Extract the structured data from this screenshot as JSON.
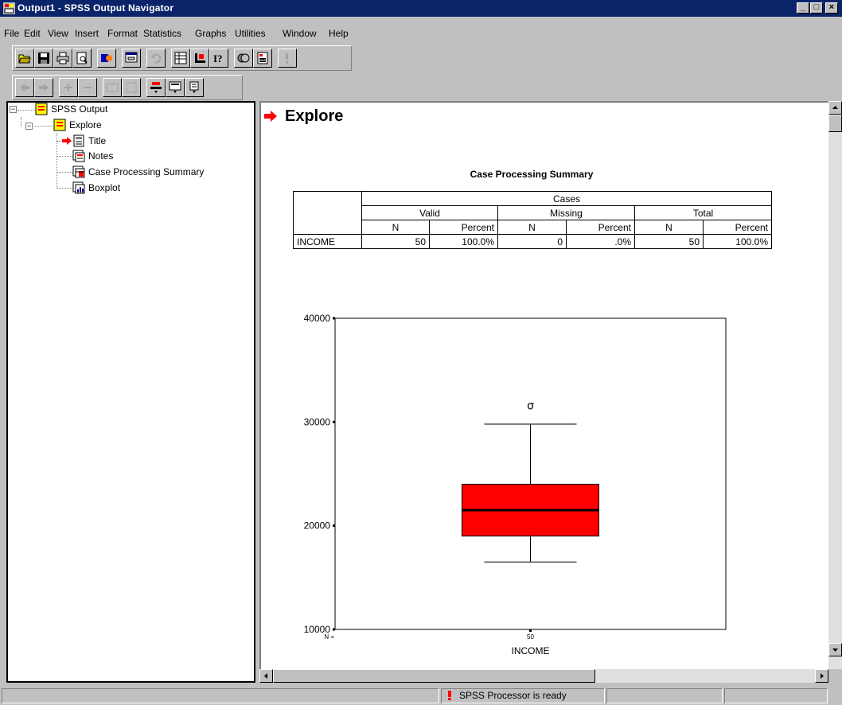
{
  "window": {
    "title": "Output1 - SPSS Output Navigator",
    "buttons": [
      "_",
      "□",
      "×"
    ]
  },
  "menu": [
    "File",
    "Edit",
    "View",
    "Insert",
    "Format",
    "Statistics",
    "Graphs",
    "Utilities",
    "Window",
    "Help"
  ],
  "toolbar1_icons": [
    "open-icon",
    "save-icon",
    "print-icon",
    "print-preview-icon",
    "export-icon",
    "recall-dialog-icon",
    "undo-icon",
    "goto-data-icon",
    "goto-case-icon",
    "variables-icon",
    "use-sets-icon",
    "designate-window-icon",
    "info-icon"
  ],
  "toolbar2_icons": [
    "promote-icon",
    "demote-icon",
    "expand-icon",
    "collapse-icon",
    "show-icon",
    "hide-icon",
    "insert-heading-icon",
    "insert-title-icon",
    "insert-text-icon"
  ],
  "outline": {
    "root": "SPSS Output",
    "explore": "Explore",
    "items": [
      "Title",
      "Notes",
      "Case Processing Summary",
      "Boxplot"
    ]
  },
  "content": {
    "heading": "Explore",
    "table": {
      "title": "Case Processing Summary",
      "group_header": "Cases",
      "subgroups": [
        "Valid",
        "Missing",
        "Total"
      ],
      "col_headers": [
        "N",
        "Percent",
        "N",
        "Percent",
        "N",
        "Percent"
      ],
      "row_label": "INCOME",
      "row_values": [
        "50",
        "100.0%",
        "0",
        ".0%",
        "50",
        "100.0%"
      ]
    }
  },
  "chart_data": {
    "type": "boxplot",
    "variable": "INCOME",
    "xlabel": "INCOME",
    "x_tick_labels": [
      "N =",
      "50"
    ],
    "y_ticks": [
      10000,
      20000,
      30000,
      40000
    ],
    "y_tick_labels": [
      "10000",
      "20000",
      "30000",
      "40000"
    ],
    "ylim": [
      10000,
      40000
    ],
    "box": {
      "min": 16500,
      "q1": 19000,
      "median": 21500,
      "q3": 24000,
      "max": 29800
    },
    "outliers": [
      {
        "value": 31600,
        "label": "σ"
      }
    ],
    "box_color": "#ff0000"
  },
  "status": {
    "message": "SPSS Processor is ready"
  },
  "colors": {
    "titlebar": "#0a246a",
    "accent_red": "#ff0000",
    "chrome": "#c0c0c0"
  }
}
